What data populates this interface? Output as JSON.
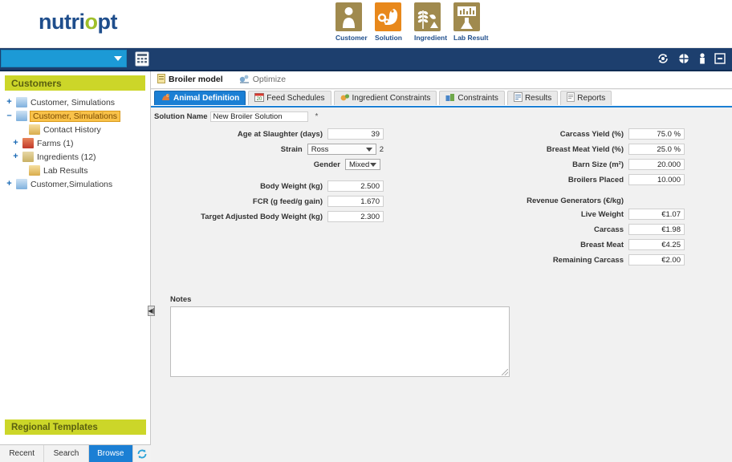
{
  "brand": {
    "part1": "nutri",
    "part2": "o",
    "part3": "pt"
  },
  "topnav": [
    {
      "label": "Customer",
      "icon": "customer-icon"
    },
    {
      "label": "Solution",
      "icon": "solution-icon"
    },
    {
      "label": "Ingredient",
      "icon": "ingredient-icon"
    },
    {
      "label": "Lab Result",
      "icon": "lab-result-icon"
    }
  ],
  "toolbar": {
    "select_value": "",
    "grid_icon": "calculator-icon",
    "right_icons": [
      "sync-icon",
      "globe-icon",
      "lock-icon",
      "minimize-icon"
    ]
  },
  "sidebar": {
    "header": "Customers",
    "tree": [
      {
        "label": "Customer, Simulations",
        "expander": "+",
        "icon": "person-icon",
        "level": 1,
        "selected": false
      },
      {
        "label": "Customer, Simulations",
        "expander": "–",
        "icon": "person-icon",
        "level": 1,
        "selected": true
      },
      {
        "label": "Contact History",
        "expander": "",
        "icon": "folder-icon",
        "level": 2,
        "selected": false
      },
      {
        "label": "Farms (1)",
        "expander": "+",
        "icon": "farm-icon",
        "level": 2,
        "selected": false
      },
      {
        "label": "Ingredients (12)",
        "expander": "+",
        "icon": "grain-icon",
        "level": 2,
        "selected": false
      },
      {
        "label": "Lab Results",
        "expander": "",
        "icon": "folder-icon",
        "level": 2,
        "selected": false
      },
      {
        "label": "Customer,Simulations",
        "expander": "+",
        "icon": "person-icon",
        "level": 1,
        "selected": false
      }
    ],
    "footer_header": "Regional Templates",
    "tabs": [
      {
        "label": "Recent",
        "active": false
      },
      {
        "label": "Search",
        "active": false
      },
      {
        "label": "Browse",
        "active": true
      }
    ],
    "refresh_icon": "refresh-icon"
  },
  "main": {
    "doc_tabs": [
      {
        "label": "Broiler model",
        "active": true,
        "icon": "document-icon"
      },
      {
        "label": "Optimize",
        "active": false,
        "icon": "optimize-icon"
      }
    ],
    "sub_tabs": [
      {
        "label": "Animal Definition",
        "active": true,
        "icon": "animal-icon"
      },
      {
        "label": "Feed Schedules",
        "active": false,
        "icon": "calendar-icon"
      },
      {
        "label": "Ingredient Constraints",
        "active": false,
        "icon": "ingredient-constraint-icon"
      },
      {
        "label": "Constraints",
        "active": false,
        "icon": "constraints-icon"
      },
      {
        "label": "Results",
        "active": false,
        "icon": "results-icon"
      },
      {
        "label": "Reports",
        "active": false,
        "icon": "reports-icon"
      }
    ],
    "solution_name": {
      "label": "Solution Name",
      "value": "New Broiler Solution",
      "required_marker": "*"
    },
    "left_fields": [
      {
        "label": "Age at Slaughter (days)",
        "value": "39",
        "type": "text"
      },
      {
        "label": "Strain",
        "value": "Ross",
        "type": "select",
        "suffix": "2"
      },
      {
        "label": "Gender",
        "value": "Mixed",
        "type": "select-narrow",
        "suffix": ""
      },
      {
        "label": "Body Weight (kg)",
        "value": "2.500",
        "type": "text"
      },
      {
        "label": "FCR (g feed/g gain)",
        "value": "1.670",
        "type": "text"
      },
      {
        "label": "Target Adjusted Body Weight (kg)",
        "value": "2.300",
        "type": "text"
      }
    ],
    "right_fields": [
      {
        "label": "Carcass Yield (%)",
        "value": "75.0 %",
        "type": "text"
      },
      {
        "label": "Breast Meat Yield (%)",
        "value": "25.0 %",
        "type": "text"
      },
      {
        "label": "Barn Size (m²)",
        "value": "20.000",
        "type": "text"
      },
      {
        "label": "Broilers Placed",
        "value": "10.000",
        "type": "text"
      }
    ],
    "revenue_section_label": "Revenue Generators (€/kg)",
    "revenue_fields": [
      {
        "label": "Live Weight",
        "value": "€1.07"
      },
      {
        "label": "Carcass",
        "value": "€1.98"
      },
      {
        "label": "Breast Meat",
        "value": "€4.25"
      },
      {
        "label": "Remaining Carcass",
        "value": "€2.00"
      }
    ],
    "notes": {
      "label": "Notes",
      "value": "",
      "placeholder": ""
    }
  },
  "colors": {
    "brand_blue": "#1f4e8c",
    "brand_green": "#9fbf2a",
    "toolbar_blue": "#1d3f6e",
    "accent_blue": "#1b7fd4",
    "sidebar_header_green": "#ccd629",
    "selection_orange": "#f9c24a"
  }
}
